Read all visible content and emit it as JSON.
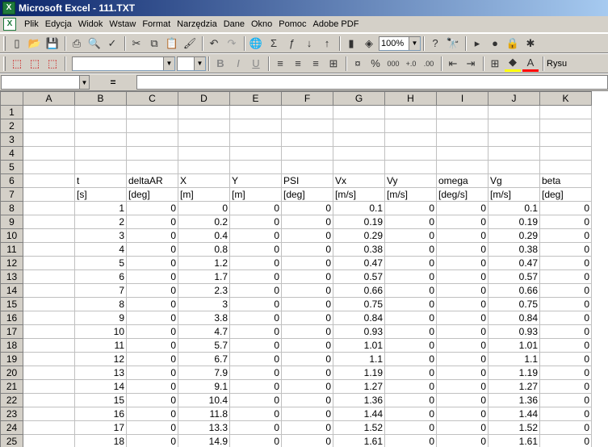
{
  "window": {
    "title": "Microsoft Excel - 111.TXT"
  },
  "menu": [
    "Plik",
    "Edycja",
    "Widok",
    "Wstaw",
    "Format",
    "Narzędzia",
    "Dane",
    "Okno",
    "Pomoc",
    "Adobe PDF"
  ],
  "toolbar": {
    "zoom": "100%",
    "rysuj": "Rysu"
  },
  "formula": {
    "equals": "="
  },
  "columns": [
    "A",
    "B",
    "C",
    "D",
    "E",
    "F",
    "G",
    "H",
    "I",
    "J",
    "K"
  ],
  "rows": [
    {
      "n": "1",
      "c": [
        "",
        "",
        "",
        "",
        "",
        "",
        "",
        "",
        "",
        "",
        ""
      ]
    },
    {
      "n": "2",
      "c": [
        "",
        "",
        "",
        "",
        "",
        "",
        "",
        "",
        "",
        "",
        ""
      ]
    },
    {
      "n": "3",
      "c": [
        "",
        "",
        "",
        "",
        "",
        "",
        "",
        "",
        "",
        "",
        ""
      ]
    },
    {
      "n": "4",
      "c": [
        "",
        "",
        "",
        "",
        "",
        "",
        "",
        "",
        "",
        "",
        ""
      ]
    },
    {
      "n": "5",
      "c": [
        "",
        "",
        "",
        "",
        "",
        "",
        "",
        "",
        "",
        "",
        ""
      ]
    },
    {
      "n": "6",
      "c": [
        "",
        "t",
        "deltaAR",
        "X",
        "Y",
        "PSI",
        "Vx",
        "Vy",
        "omega",
        "Vg",
        "beta"
      ]
    },
    {
      "n": "7",
      "c": [
        "",
        "[s]",
        "[deg]",
        "[m]",
        "[m]",
        "[deg]",
        "[m/s]",
        "[m/s]",
        "[deg/s]",
        "[m/s]",
        "[deg]"
      ]
    },
    {
      "n": "8",
      "c": [
        "",
        "1",
        "0",
        "0",
        "0",
        "0",
        "0.1",
        "0",
        "0",
        "0.1",
        "0"
      ]
    },
    {
      "n": "9",
      "c": [
        "",
        "2",
        "0",
        "0.2",
        "0",
        "0",
        "0.19",
        "0",
        "0",
        "0.19",
        "0"
      ]
    },
    {
      "n": "10",
      "c": [
        "",
        "3",
        "0",
        "0.4",
        "0",
        "0",
        "0.29",
        "0",
        "0",
        "0.29",
        "0"
      ]
    },
    {
      "n": "11",
      "c": [
        "",
        "4",
        "0",
        "0.8",
        "0",
        "0",
        "0.38",
        "0",
        "0",
        "0.38",
        "0"
      ]
    },
    {
      "n": "12",
      "c": [
        "",
        "5",
        "0",
        "1.2",
        "0",
        "0",
        "0.47",
        "0",
        "0",
        "0.47",
        "0"
      ]
    },
    {
      "n": "13",
      "c": [
        "",
        "6",
        "0",
        "1.7",
        "0",
        "0",
        "0.57",
        "0",
        "0",
        "0.57",
        "0"
      ]
    },
    {
      "n": "14",
      "c": [
        "",
        "7",
        "0",
        "2.3",
        "0",
        "0",
        "0.66",
        "0",
        "0",
        "0.66",
        "0"
      ]
    },
    {
      "n": "15",
      "c": [
        "",
        "8",
        "0",
        "3",
        "0",
        "0",
        "0.75",
        "0",
        "0",
        "0.75",
        "0"
      ]
    },
    {
      "n": "16",
      "c": [
        "",
        "9",
        "0",
        "3.8",
        "0",
        "0",
        "0.84",
        "0",
        "0",
        "0.84",
        "0"
      ]
    },
    {
      "n": "17",
      "c": [
        "",
        "10",
        "0",
        "4.7",
        "0",
        "0",
        "0.93",
        "0",
        "0",
        "0.93",
        "0"
      ]
    },
    {
      "n": "18",
      "c": [
        "",
        "11",
        "0",
        "5.7",
        "0",
        "0",
        "1.01",
        "0",
        "0",
        "1.01",
        "0"
      ]
    },
    {
      "n": "19",
      "c": [
        "",
        "12",
        "0",
        "6.7",
        "0",
        "0",
        "1.1",
        "0",
        "0",
        "1.1",
        "0"
      ]
    },
    {
      "n": "20",
      "c": [
        "",
        "13",
        "0",
        "7.9",
        "0",
        "0",
        "1.19",
        "0",
        "0",
        "1.19",
        "0"
      ]
    },
    {
      "n": "21",
      "c": [
        "",
        "14",
        "0",
        "9.1",
        "0",
        "0",
        "1.27",
        "0",
        "0",
        "1.27",
        "0"
      ]
    },
    {
      "n": "22",
      "c": [
        "",
        "15",
        "0",
        "10.4",
        "0",
        "0",
        "1.36",
        "0",
        "0",
        "1.36",
        "0"
      ]
    },
    {
      "n": "23",
      "c": [
        "",
        "16",
        "0",
        "11.8",
        "0",
        "0",
        "1.44",
        "0",
        "0",
        "1.44",
        "0"
      ]
    },
    {
      "n": "24",
      "c": [
        "",
        "17",
        "0",
        "13.3",
        "0",
        "0",
        "1.52",
        "0",
        "0",
        "1.52",
        "0"
      ]
    },
    {
      "n": "25",
      "c": [
        "",
        "18",
        "0",
        "14.9",
        "0",
        "0",
        "1.61",
        "0",
        "0",
        "1.61",
        "0"
      ]
    }
  ]
}
